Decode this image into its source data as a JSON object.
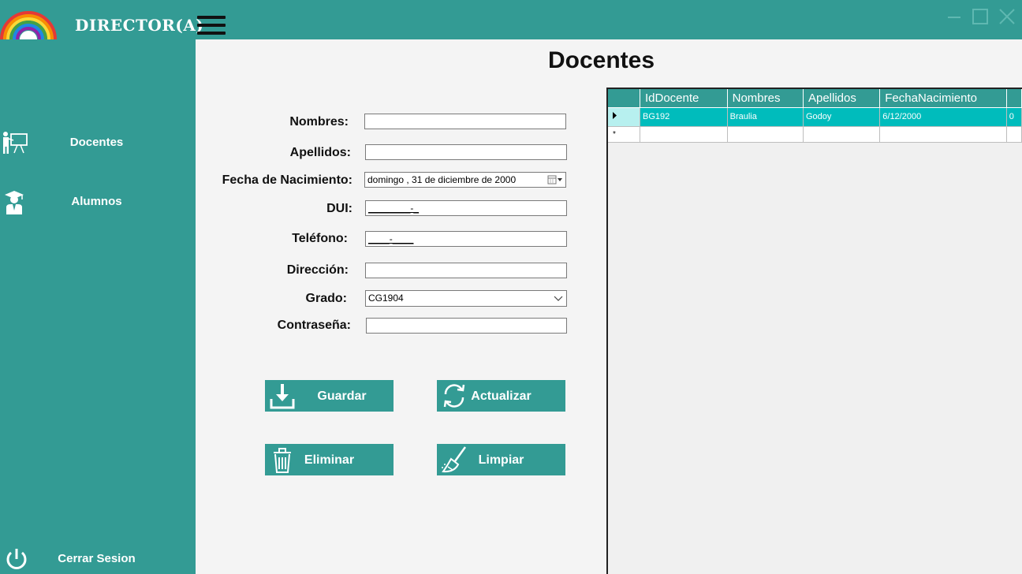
{
  "app": {
    "title": "DIRECTOR(A)",
    "window_controls": [
      "minimize-icon",
      "maximize-icon",
      "close-icon"
    ]
  },
  "sidebar": {
    "items": [
      {
        "label": "Docentes",
        "icon": "teacher-board-icon"
      },
      {
        "label": "Alumnos",
        "icon": "graduate-student-icon"
      }
    ],
    "logout": {
      "label": "Cerrar Sesion",
      "icon": "power-icon"
    }
  },
  "page": {
    "title": "Docentes"
  },
  "form": {
    "nombres": {
      "label": "Nombres:",
      "value": ""
    },
    "apellidos": {
      "label": "Apellidos:",
      "value": ""
    },
    "fecha_nacimiento": {
      "label": "Fecha de Nacimiento:",
      "value": "domingo , 31 de  diciembre  de 2000"
    },
    "dui": {
      "label": "DUI:",
      "value": "________-_"
    },
    "telefono": {
      "label": "Teléfono:",
      "value": "____-____"
    },
    "direccion": {
      "label": "Dirección:",
      "value": ""
    },
    "grado": {
      "label": "Grado:",
      "value": "CG1904"
    },
    "contrasena": {
      "label": "Contraseña:",
      "value": ""
    }
  },
  "buttons": {
    "guardar": "Guardar",
    "actualizar": "Actualizar",
    "eliminar": "Eliminar",
    "limpiar": "Limpiar"
  },
  "grid": {
    "columns": [
      "IdDocente",
      "Nombres",
      "Apellidos",
      "FechaNacimiento",
      ""
    ],
    "rows": [
      [
        "BG192",
        "Braulia",
        "Godoy",
        "6/12/2000",
        "0"
      ]
    ],
    "new_row_marker": "*"
  },
  "colors": {
    "teal": "#339b94",
    "selected_row": "#00bcbc",
    "background": "#f4f4f4"
  }
}
